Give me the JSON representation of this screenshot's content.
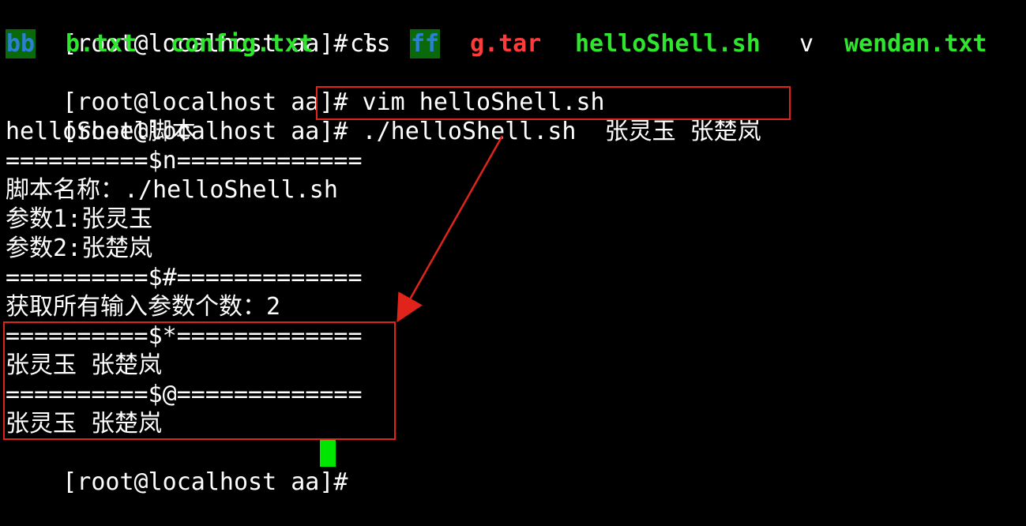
{
  "terminal": {
    "lines": [
      {
        "prompt": "[root@localhost aa]# ",
        "text": "ls"
      },
      {
        "prompt": "[root@localhost aa]# ",
        "text": "vim helloShell.sh"
      },
      {
        "prompt": "[root@localhost aa]# ",
        "text": "./helloShell.sh  张灵玉 张楚岚"
      },
      {
        "text": "helloSheel脚本"
      },
      {
        "text": "==========$n============="
      },
      {
        "text": "脚本名称：./helloShell.sh"
      },
      {
        "text": "参数1:张灵玉"
      },
      {
        "text": "参数2:张楚岚"
      },
      {
        "text": "==========$#============="
      },
      {
        "text": "获取所有输入参数个数：2"
      },
      {
        "text": "==========$*============="
      },
      {
        "text": "张灵玉 张楚岚"
      },
      {
        "text": "==========$@============="
      },
      {
        "text": "张灵玉 张楚岚"
      },
      {
        "prompt": "[root@localhost aa]# ",
        "text": ""
      }
    ],
    "ls_output": [
      {
        "name": "bb",
        "color": "#2a7fd6",
        "bg": "#0a6a0a"
      },
      {
        "name": "b.txt",
        "color": "#2ee62e"
      },
      {
        "name": "config.txt",
        "color": "#2ee62e"
      },
      {
        "name": "cs",
        "color": "#ffffff"
      },
      {
        "name": "ff",
        "color": "#2a7fd6",
        "bg": "#0a6a0a"
      },
      {
        "name": "g.tar",
        "color": "#ff3b3b"
      },
      {
        "name": "helloShell.sh",
        "color": "#2ee62e"
      },
      {
        "name": "v",
        "color": "#ffffff"
      },
      {
        "name": "wendan.txt",
        "color": "#2ee62e"
      }
    ],
    "colors": {
      "background": "#000000",
      "foreground": "#ffffff",
      "annotation": "#e0241c",
      "cursor": "#00e600"
    }
  }
}
